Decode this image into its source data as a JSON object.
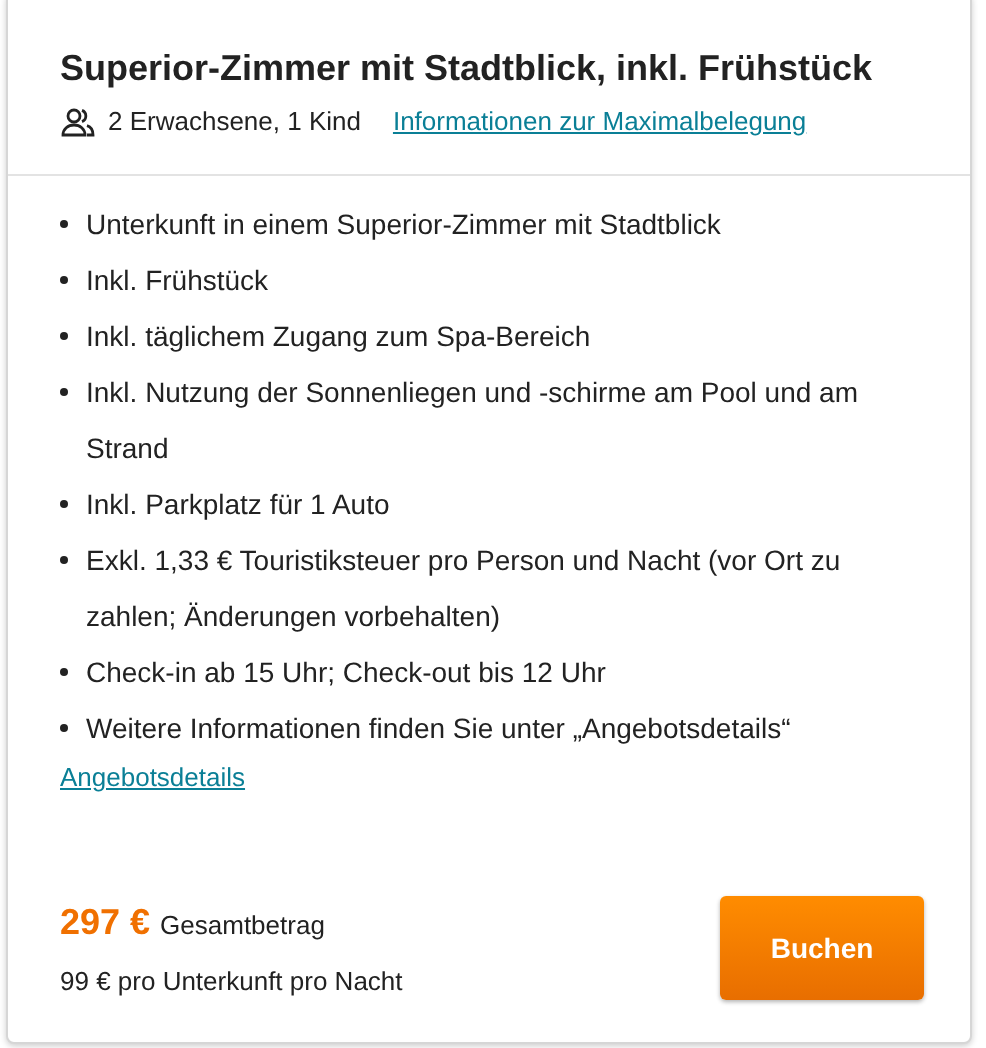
{
  "offer": {
    "title": "Superior-Zimmer mit Stadtblick, inkl. Frühstück",
    "occupancy": "2 Erwachsene, 1 Kind",
    "occupancy_link": "Informationen zur Maximalbelegung",
    "features": [
      "Unterkunft in einem Superior-Zimmer mit Stadtblick",
      "Inkl. Frühstück",
      "Inkl. täglichem Zugang zum Spa-Bereich",
      "Inkl. Nutzung der Sonnenliegen und -schirme am Pool und am Strand",
      "Inkl. Parkplatz für 1 Auto",
      "Exkl. 1,33 € Touristiksteuer pro Person und Nacht (vor Ort zu zahlen; Änderungen vorbehalten)",
      "Check-in ab 15 Uhr; Check-out bis 12 Uhr",
      "Weitere Informationen finden Sie unter „Angebotsdetails“"
    ],
    "details_link": "Angebotsdetails",
    "price": "297 €",
    "price_label": "Gesamtbetrag",
    "per_night": "99 € pro Unterkunft pro Nacht",
    "book_button": "Buchen"
  }
}
